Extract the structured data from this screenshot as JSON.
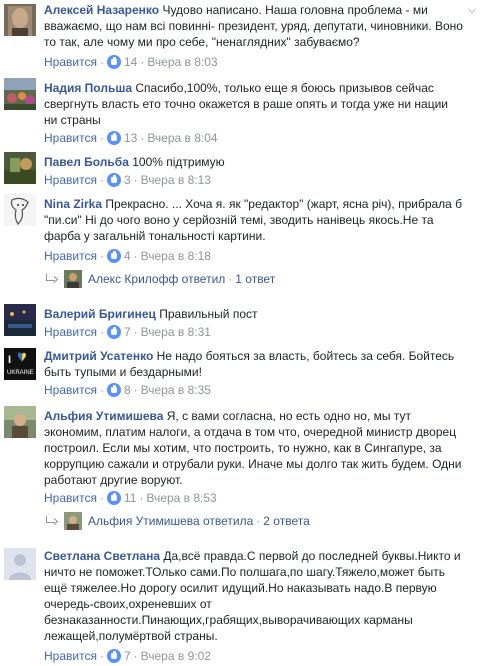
{
  "comments": [
    {
      "author": "Алексей Назаренко",
      "text": "Чудово написано. Наша головна проблема - ми вважаємо, що нам всі повинні- президент, уряд, депутати, чиновники. Воно то так, але чому ми про себе, \"ненаглядних\" забуваємо?",
      "like_label": "Нравится",
      "reactions": "14",
      "time": "Вчера в 8:03"
    },
    {
      "author": "Надия Польша",
      "text": "Спасибо,100%, только еще я боюсь призывов сейчас свергнуть власть ето точно окажется в раше опять и тогда уже ни нации ни страны",
      "like_label": "Нравится",
      "reactions": "13",
      "time": "Вчера в 8:04"
    },
    {
      "author": "Павел Больба",
      "text": "100% підтримую",
      "like_label": "Нравится",
      "reactions": "3",
      "time": "Вчера в 8:13"
    },
    {
      "author": "Nina Zirka",
      "text": "Прекрасно. ... Хоча я. як \"редактор\" (жарт, ясна річ), прибрала б \"пи.си\" Ні до чого воно у серйозній темі, зводить нанівець якось.Не та фарба у загальній тональності картини.",
      "like_label": "Нравится",
      "reactions": "4",
      "time": "Вчера в 8:18",
      "reply_name": "Алекс Крилофф ответил",
      "reply_count": "1 ответ"
    },
    {
      "author": "Валерий Бригинец",
      "text": "Правильный пост",
      "like_label": "Нравится",
      "reactions": "7",
      "time": "Вчера в 8:31"
    },
    {
      "author": "Дмитрий Усатенко",
      "text": "Не надо бояться за власть, бойтесь за себя. Бойтесь быть тупыми и бездарными!",
      "like_label": "Нравится",
      "reactions": "8",
      "time": "Вчера в 8:35",
      "avatar_text": "UKRAINE"
    },
    {
      "author": "Альфия Утимишева",
      "text": "Я, с вами согласна, но есть одно но, мы тут экономим, платим налоги, а отдача в том что, очередной министр дворец построил. Если мы хотим, что построить, то нужно, как в Сингапуре, за коррупцию сажали и отрубали руки. Иначе мы долго так жить будем. Одни работают другие воруют.",
      "like_label": "Нравится",
      "reactions": "11",
      "time": "Вчера в 8:53",
      "reply_name": "Альфия Утимишева ответила",
      "reply_count": "2 ответа"
    },
    {
      "author": "Светлана Светлана",
      "text": "Да,всё правда.С первой до последней буквы.Никто и ничто не поможет.ТОлько сами.По полшага,по шагу.Тяжело,может быть ещё тяжелее.Но дорогу осилит идущий.Но наказывать надо.В первую очередь-своих,охреневших от безнаказанности.Пинающих,грабящих,выворачивающих карманы лежащей,полумёртвой страны.",
      "like_label": "Нравится",
      "reactions": "7",
      "time": "Вчера в 9:02"
    }
  ]
}
